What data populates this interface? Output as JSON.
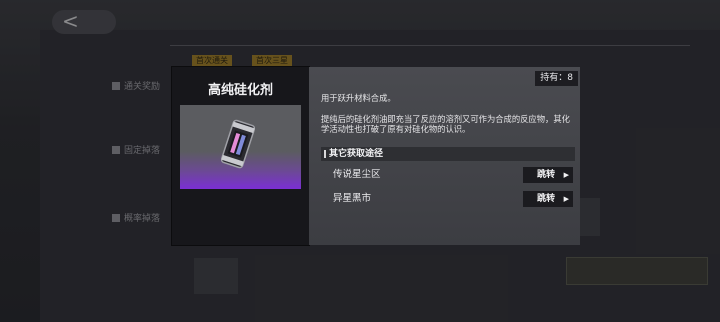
{
  "background": {
    "tags": [
      "首次通关",
      "首次三星"
    ],
    "rows": [
      "通关奖励",
      "固定掉落",
      "概率掉落"
    ]
  },
  "dialog": {
    "item_name": "高纯硅化剂",
    "owned_label": "持有：8",
    "description_short": "用于跃升材料合成。",
    "description_long": "提纯后的硅化剂油即充当了反应的溶剂又可作为合成的反应物，其化学活动性也打破了原有对硅化物的认识。",
    "sources_title": "其它获取途径",
    "sources": [
      {
        "name": "传说星尘区",
        "jump_label": "跳转"
      },
      {
        "name": "异星黑市",
        "jump_label": "跳转"
      }
    ]
  },
  "colors": {
    "accent_purple": "#7b2fd4",
    "tag_gold": "#9a7a25"
  }
}
